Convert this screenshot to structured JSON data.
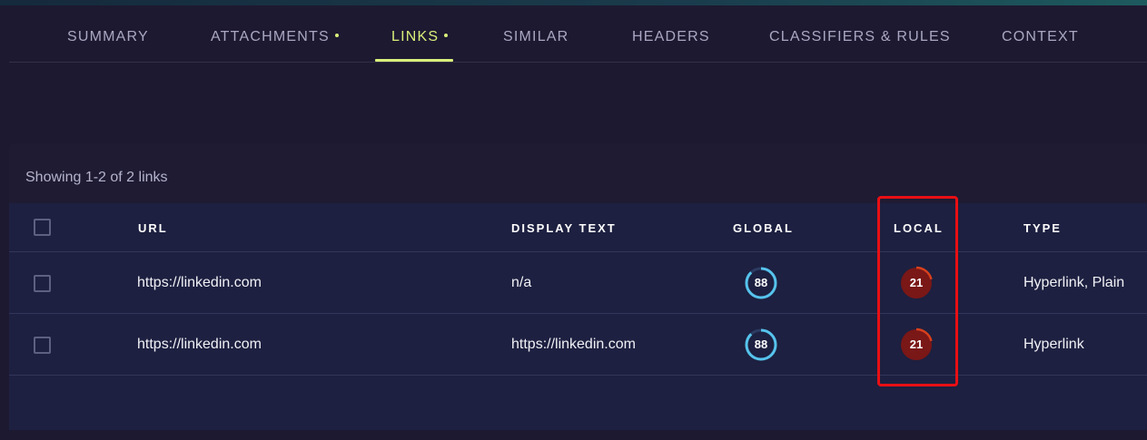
{
  "tabs": [
    {
      "label": "SUMMARY",
      "dot": false
    },
    {
      "label": "ATTACHMENTS",
      "dot": true
    },
    {
      "label": "LINKS",
      "dot": true,
      "active": true
    },
    {
      "label": "SIMILAR",
      "dot": false
    },
    {
      "label": "HEADERS",
      "dot": false
    },
    {
      "label": "CLASSIFIERS & RULES",
      "dot": false
    },
    {
      "label": "CONTEXT",
      "dot": false
    }
  ],
  "links_panel": {
    "showing_text": "Showing 1-2 of 2 links",
    "columns": {
      "url": "URL",
      "display_text": "DISPLAY TEXT",
      "global": "GLOBAL",
      "local": "LOCAL",
      "type": "TYPE"
    },
    "rows": [
      {
        "url": "https://linkedin.com",
        "display_text": "n/a",
        "global": "88",
        "local": "21",
        "type": "Hyperlink, Plain"
      },
      {
        "url": "https://linkedin.com",
        "display_text": "https://linkedin.com",
        "global": "88",
        "local": "21",
        "type": "Hyperlink"
      }
    ]
  },
  "colors": {
    "background": "#1d1931",
    "accent": "#d8ef7a",
    "global_gauge": "#56c3ec",
    "local_gauge_fill": "#7a1717",
    "local_gauge_arc": "#d8401d",
    "highlight_box": "#e80f14"
  }
}
